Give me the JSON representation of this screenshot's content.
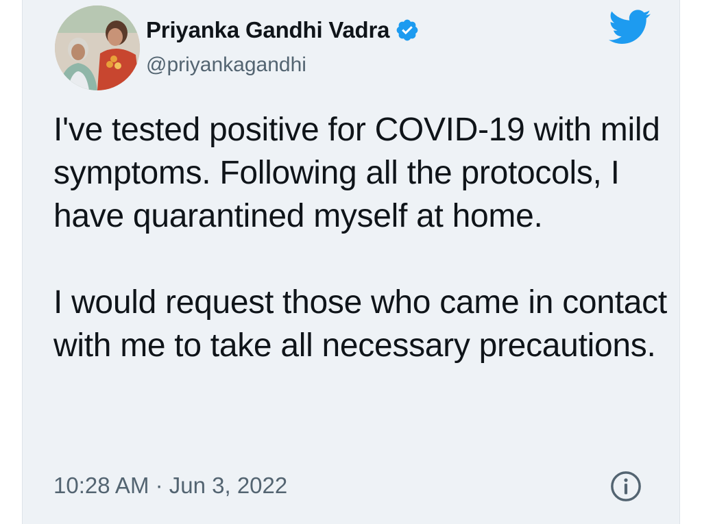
{
  "author": {
    "display_name": "Priyanka Gandhi Vadra",
    "handle": "@priyankagandhi",
    "verified": true,
    "avatar": "profile-photo"
  },
  "tweet": {
    "paragraphs": [
      "I've tested positive for COVID-19 with mild symptoms. Following all the protocols, I have quarantined myself at home.",
      "I would request those who came in contact with me to take all necessary precautions."
    ],
    "timestamp": "10:28 AM · Jun 3, 2022"
  },
  "icons": {
    "brand": "twitter-bird-icon",
    "verified": "verified-badge-icon",
    "info": "info-icon"
  },
  "colors": {
    "background": "#eef2f6",
    "twitter_blue": "#1d9bf0",
    "text": "#0f1419",
    "secondary_text": "#536471"
  }
}
